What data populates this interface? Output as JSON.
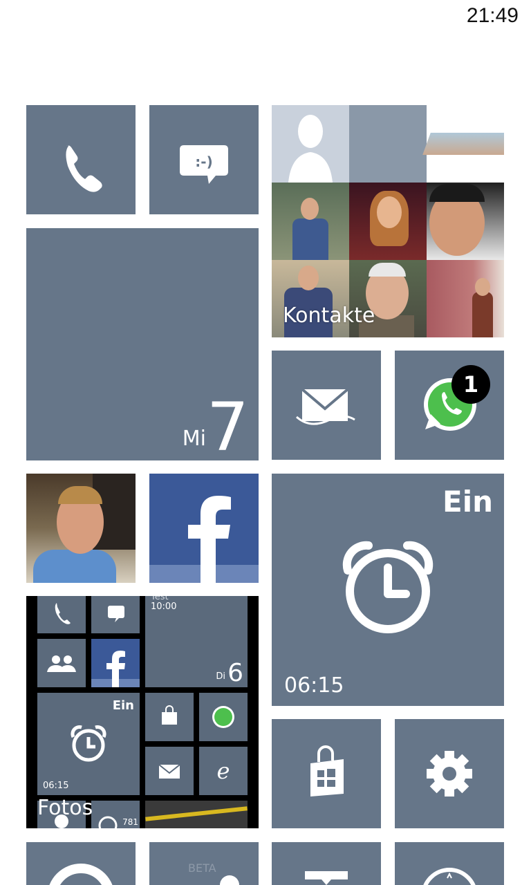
{
  "status": {
    "time": "21:49"
  },
  "tiles": {
    "phone": {
      "name": "Phone"
    },
    "messaging": {
      "name": "Messaging"
    },
    "calendar": {
      "day": "Mi",
      "date": "7"
    },
    "contacts": {
      "label": "Kontakte"
    },
    "mail": {
      "name": "Outlook Mail"
    },
    "whatsapp": {
      "badge": "1"
    },
    "alarm": {
      "status": "Ein",
      "time": "06:15"
    },
    "photos": {
      "label": "Fotos",
      "preview": {
        "calendar_event": "Test",
        "calendar_time": "10:00",
        "calendar_day": "Di",
        "calendar_date": "6",
        "alarm_status": "Ein",
        "alarm_time": "06:15",
        "feed_count": "781"
      }
    },
    "store": {
      "name": "Store"
    },
    "settings": {
      "name": "Settings"
    },
    "beta": {
      "label": "BETA"
    }
  },
  "colors": {
    "tile": "#667689",
    "facebook": "#3b5998",
    "whatsapp": "#4dbf4d"
  }
}
